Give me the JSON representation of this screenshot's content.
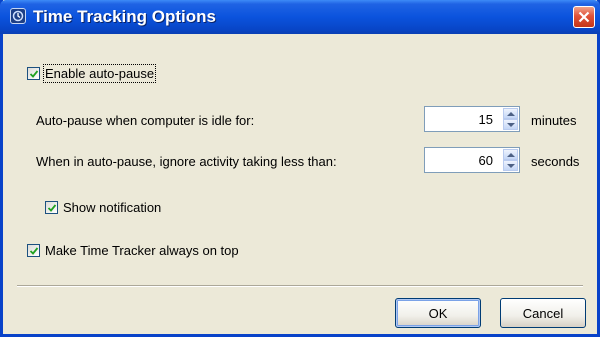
{
  "window": {
    "title": "Time Tracking Options"
  },
  "options": {
    "enable_auto_pause": {
      "label": "Enable auto-pause",
      "checked": true
    },
    "idle_row": {
      "label": "Auto-pause when computer is idle for:",
      "value": "15",
      "unit": "minutes"
    },
    "ignore_row": {
      "label": "When in auto-pause, ignore activity taking less than:",
      "value": "60",
      "unit": "seconds"
    },
    "show_notification": {
      "label": "Show notification",
      "checked": true
    },
    "always_on_top": {
      "label": "Make Time Tracker always on top",
      "checked": true
    }
  },
  "buttons": {
    "ok": "OK",
    "cancel": "Cancel"
  }
}
